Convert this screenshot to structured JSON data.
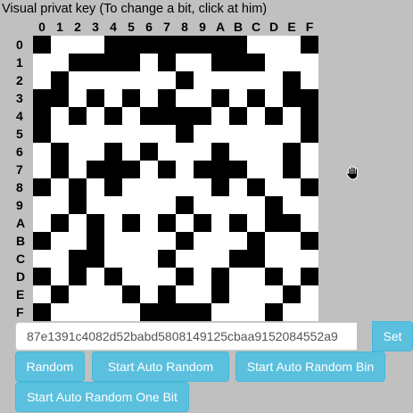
{
  "title": "Visual privat key (To change a bit, click at him)",
  "column_labels": [
    "0",
    "1",
    "2",
    "3",
    "4",
    "5",
    "6",
    "7",
    "8",
    "9",
    "A",
    "B",
    "C",
    "D",
    "E",
    "F"
  ],
  "row_labels": [
    "0",
    "1",
    "2",
    "3",
    "4",
    "5",
    "6",
    "7",
    "8",
    "9",
    "A",
    "B",
    "C",
    "D",
    "E",
    "F"
  ],
  "grid": [
    "1000111111110001",
    "0011110100111000",
    "0100000010000010",
    "1101010100101011",
    "1010101111010101",
    "1000000010000001",
    "0100101000100010",
    "0101110101110010",
    "1010100000101001",
    "0010000010000100",
    "0101010101010110",
    "1001000010001001",
    "0011000100011000",
    "1010100010100101",
    "0100010100100010",
    "1000001111000100"
  ],
  "key": {
    "value": "87e1391c4082d52babd5808149125cbaa9152084552a9"
  },
  "buttons": {
    "set": "Set",
    "random": "Random",
    "start_auto_random": "Start Auto Random",
    "start_auto_random_bin": "Start Auto Random Bin",
    "start_auto_random_one_bit": "Start Auto Random One Bit"
  },
  "icons": {
    "cursor": "hand-grab-icon"
  }
}
